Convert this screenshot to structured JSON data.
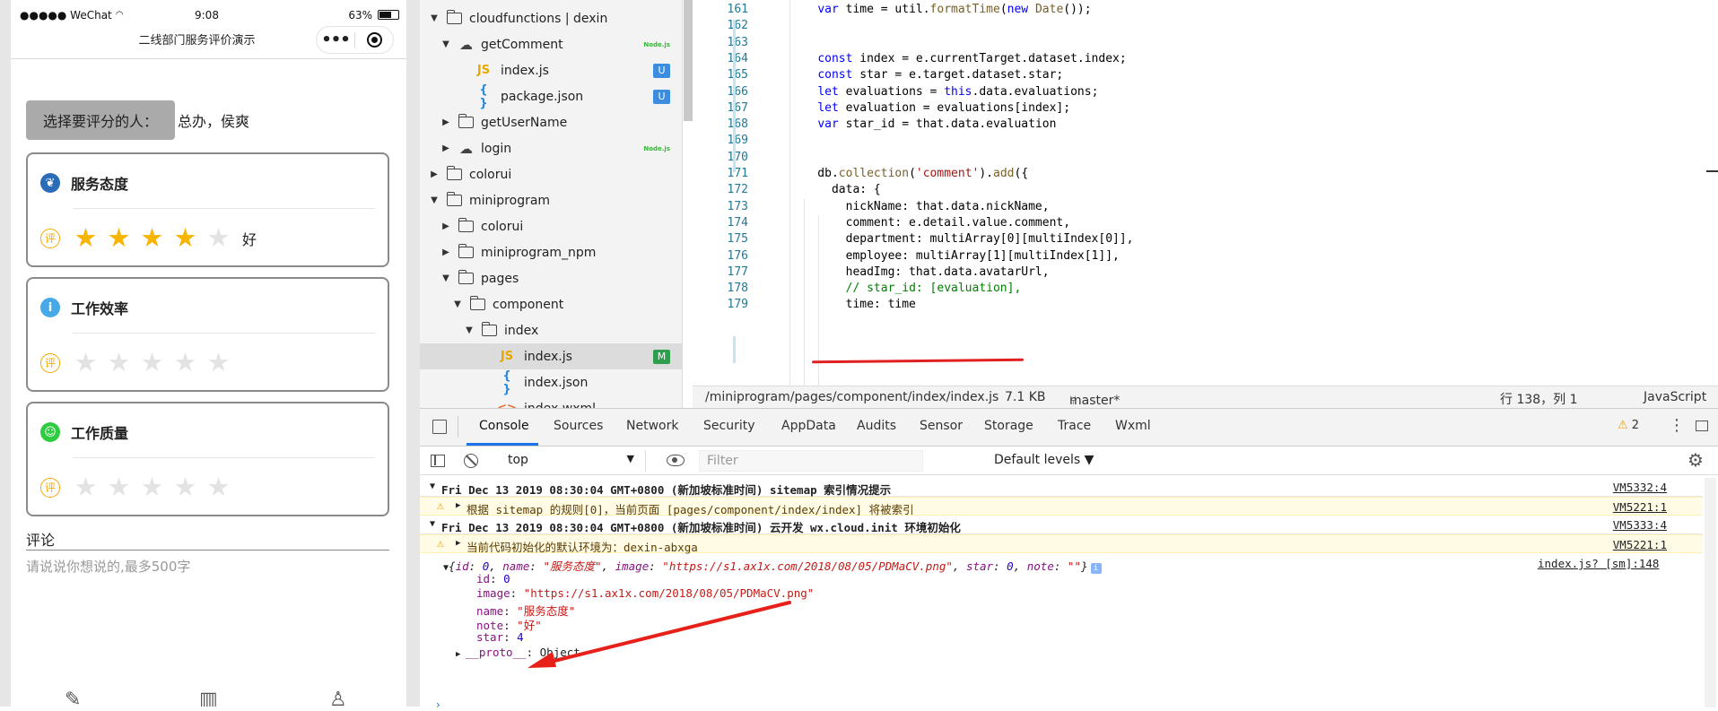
{
  "simulator": {
    "status": {
      "carrier": "●●●●● WeChat",
      "time": "9:08",
      "battery": "63%"
    },
    "nav_title": "二线部门服务评价演示",
    "capsule_more": "•••",
    "picker_label": "选择要评分的人：",
    "picker_value": "总办，侯爽",
    "rating_icon": "评",
    "cards": [
      {
        "label": "服务态度",
        "icon": "leaf-icon",
        "color": "#2b6cb8",
        "stars": 4,
        "note": "好"
      },
      {
        "label": "工作效率",
        "icon": "info-icon",
        "color": "#49a9e8",
        "stars": 0,
        "note": ""
      },
      {
        "label": "工作质量",
        "icon": "smile-icon",
        "color": "#2ecc40",
        "stars": 0,
        "note": ""
      }
    ],
    "comment_label": "评论",
    "comment_placeholder": "请说说你想说的,最多500字"
  },
  "file_tree": [
    {
      "label": "cloudfunctions | dexin",
      "kind": "folder-open",
      "depth": 0,
      "badge": ""
    },
    {
      "label": "getComment",
      "kind": "cloud-open",
      "depth": 1,
      "badge": "Node.js"
    },
    {
      "label": "index.js",
      "kind": "js",
      "depth": 2,
      "badge": "U"
    },
    {
      "label": "package.json",
      "kind": "json",
      "depth": 2,
      "badge": "U"
    },
    {
      "label": "getUserName",
      "kind": "folder",
      "depth": 1,
      "badge": ""
    },
    {
      "label": "login",
      "kind": "cloud",
      "depth": 1,
      "badge": "Node.js"
    },
    {
      "label": "colorui",
      "kind": "folder",
      "depth": 0,
      "badge": ""
    },
    {
      "label": "miniprogram",
      "kind": "folder-open",
      "depth": 0,
      "badge": ""
    },
    {
      "label": "colorui",
      "kind": "folder",
      "depth": 1,
      "badge": ""
    },
    {
      "label": "miniprogram_npm",
      "kind": "folder",
      "depth": 1,
      "badge": ""
    },
    {
      "label": "pages",
      "kind": "folder-open",
      "depth": 1,
      "badge": ""
    },
    {
      "label": "component",
      "kind": "folder-open",
      "depth": 2,
      "badge": ""
    },
    {
      "label": "index",
      "kind": "folder-open",
      "depth": 3,
      "badge": ""
    },
    {
      "label": "index.js",
      "kind": "js",
      "depth": 4,
      "badge": "M",
      "selected": true
    },
    {
      "label": "index.json",
      "kind": "json",
      "depth": 4,
      "badge": ""
    },
    {
      "label": "index.wxml",
      "kind": "wxml",
      "depth": 4,
      "badge": ""
    }
  ],
  "editor": {
    "lines": [
      {
        "n": "161",
        "html": "    <span class='kw'>var</span> time = util.<span class='fn'>formatTime</span>(<span class='kw'>new</span> <span class='fn'>Date</span>());"
      },
      {
        "n": "162",
        "html": ""
      },
      {
        "n": "163",
        "html": ""
      },
      {
        "n": "164",
        "html": "    <span class='kw'>const</span> index = e.currentTarget.dataset.index;"
      },
      {
        "n": "165",
        "html": "    <span class='kw'>const</span> star = e.target.dataset.star;"
      },
      {
        "n": "166",
        "html": "    <span class='kw'>let</span> evaluations = <span class='kw'>this</span>.data.evaluations;"
      },
      {
        "n": "167",
        "html": "    <span class='kw'>let</span> evaluation = evaluations[index];"
      },
      {
        "n": "168",
        "html": "    <span class='kw'>var</span> star_id = that.data.evaluation"
      },
      {
        "n": "169",
        "html": ""
      },
      {
        "n": "170",
        "html": ""
      },
      {
        "n": "171",
        "html": "    db.<span class='fn'>collection</span>(<span class='str'>'comment'</span>).<span class='fn'>add</span>({"
      },
      {
        "n": "172",
        "html": "      data: {"
      },
      {
        "n": "173",
        "html": "        nickName: that.data.nickName,"
      },
      {
        "n": "174",
        "html": "        comment: e.detail.value.comment,"
      },
      {
        "n": "175",
        "html": "        department: multiArray[0][multiIndex[0]],"
      },
      {
        "n": "176",
        "html": "        employee: multiArray[1][multiIndex[1]],"
      },
      {
        "n": "177",
        "html": "        headImg: that.data.avatarUrl,"
      },
      {
        "n": "178",
        "html": "        <span class='cmt'>// star_id: [evaluation],</span>"
      },
      {
        "n": "179",
        "html": "        time: time"
      }
    ],
    "status": {
      "path": "/miniprogram/pages/component/index/index.js",
      "size": "7.1 KB",
      "branch": "master*",
      "position": "行 138，列 1",
      "language": "JavaScript"
    }
  },
  "devtools": {
    "tabs": [
      "Console",
      "Sources",
      "Network",
      "Security",
      "AppData",
      "Audits",
      "Sensor",
      "Storage",
      "Trace",
      "Wxml"
    ],
    "active_tab": "Console",
    "warning_count": "2",
    "context": "top",
    "filter_placeholder": "Filter",
    "levels": "Default levels ▼",
    "logs": [
      {
        "type": "group",
        "text": "Fri Dec 13 2019 08:30:04 GMT+0800 (新加坡标准时间) sitemap 索引情况提示",
        "src": "VM5332:4"
      },
      {
        "type": "warn",
        "text": "根据 sitemap 的规则[0]，当前页面 [pages/component/index/index] 将被索引",
        "src": "VM5221:1"
      },
      {
        "type": "group",
        "text": "Fri Dec 13 2019 08:30:04 GMT+0800 (新加坡标准时间) 云开发 wx.cloud.init 环境初始化",
        "src": "VM5333:4"
      },
      {
        "type": "warn",
        "text": "当前代码初始化的默认环境为：dexin-abxga",
        "src": "VM5221:1"
      }
    ],
    "object": {
      "summary_id": "0",
      "summary_name": "服务态度",
      "summary_image": "https://s1.ax1x.com/2018/08/05/PDMaCV.png",
      "summary_star": "0",
      "summary_note": "",
      "src": "index.js? [sm]:148",
      "props": [
        {
          "k": "id",
          "v": "0",
          "t": "n"
        },
        {
          "k": "image",
          "v": "\"https://s1.ax1x.com/2018/08/05/PDMaCV.png\"",
          "t": "s"
        },
        {
          "k": "name",
          "v": "\"服务态度\"",
          "t": "s"
        },
        {
          "k": "note",
          "v": "\"好\"",
          "t": "s"
        },
        {
          "k": "star",
          "v": "4",
          "t": "n"
        }
      ],
      "proto": "Object"
    }
  }
}
